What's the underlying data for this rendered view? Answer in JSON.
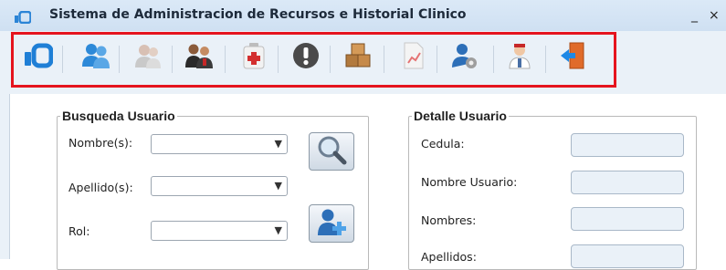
{
  "window": {
    "title": "Sistema de Administracion de Recursos e Historial Clinico",
    "minimize_glyph": "_",
    "close_glyph": "×"
  },
  "toolbar": {
    "highlight_color": "#e5141e",
    "buttons": [
      {
        "icon": "app-logo-icon"
      },
      {
        "icon": "users-icon"
      },
      {
        "icon": "patients-icon"
      },
      {
        "icon": "staff-icon"
      },
      {
        "icon": "first-aid-icon"
      },
      {
        "icon": "alert-icon"
      },
      {
        "icon": "boxes-icon"
      },
      {
        "icon": "report-chart-icon"
      },
      {
        "icon": "user-settings-icon"
      },
      {
        "icon": "doctor-icon"
      },
      {
        "icon": "exit-door-icon"
      }
    ]
  },
  "search_panel": {
    "legend": "Busqueda Usuario",
    "nombre_label": "Nombre(s):",
    "nombre_value": "",
    "apellido_label": "Apellido(s):",
    "apellido_value": "",
    "rol_label": "Rol:",
    "rol_value": ""
  },
  "detail_panel": {
    "legend": "Detalle Usuario",
    "cedula_label": "Cedula:",
    "cedula_value": "",
    "usuario_label": "Nombre Usuario:",
    "usuario_value": "",
    "nombres_label": "Nombres:",
    "nombres_value": "",
    "apellidos_label": "Apellidos:",
    "apellidos_value": ""
  }
}
